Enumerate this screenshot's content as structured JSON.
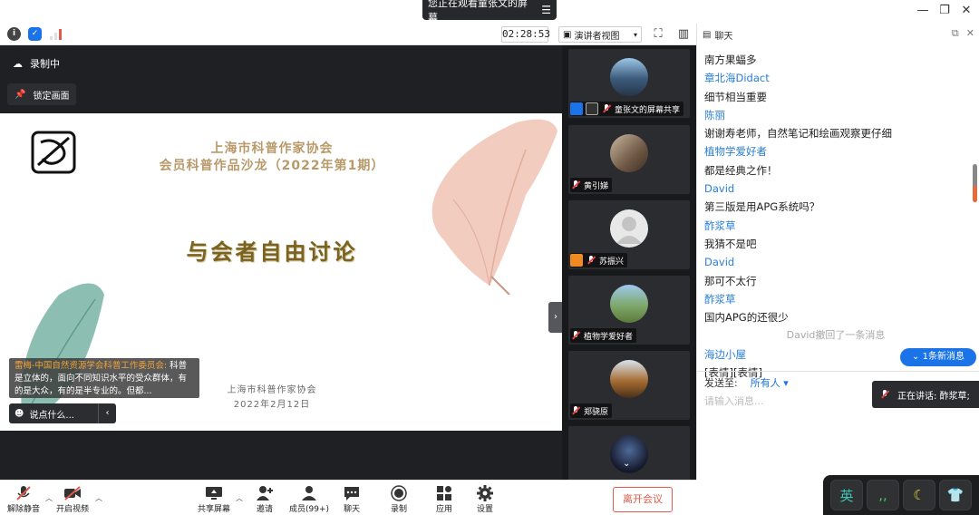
{
  "titlebar": {
    "share_banner": "您正在观看童张文的屏幕",
    "menu_icon": "menu-icon"
  },
  "toolbar": {
    "timer": "02:28:53",
    "view_label": "演讲者视图",
    "icons": [
      "info-icon",
      "shield-icon",
      "signal-icon",
      "fullscreen-icon",
      "sidebar-toggle-icon"
    ]
  },
  "stage": {
    "recording_label": "录制中",
    "lock_label": "锁定画面",
    "slide": {
      "title_line1": "上海市科普作家协会",
      "title_line2": "会员科普作品沙龙（2022年第1期）",
      "heading": "与会者自由讨论",
      "org": "上海市科普作家协会",
      "date": "2022年2月12日"
    },
    "comment": {
      "author": "雷梅-中国自然资源学会科普工作委员会:",
      "text": " 科普是立体的，面向不同知识水平的受众群体，有的是大众，有的是半专业的。但都..."
    },
    "say_placeholder": "说点什么..."
  },
  "gallery": [
    {
      "name": "童张文的屏幕共享"
    },
    {
      "name": "黄引娣"
    },
    {
      "name": "苏振兴"
    },
    {
      "name": "植物学爱好者"
    },
    {
      "name": "郑骁原"
    },
    {
      "name": ""
    }
  ],
  "chat": {
    "title": "聊天",
    "messages": [
      {
        "kind": "text",
        "content": "南方果蝠多"
      },
      {
        "kind": "name",
        "content": "章北海Didact"
      },
      {
        "kind": "text",
        "content": "细节相当重要"
      },
      {
        "kind": "name",
        "content": "陈丽"
      },
      {
        "kind": "text",
        "content": "谢谢寿老师，自然笔记和绘画观察更仔细"
      },
      {
        "kind": "name",
        "content": "植物学爱好者"
      },
      {
        "kind": "text",
        "content": "都是经典之作！"
      },
      {
        "kind": "name",
        "content": "David"
      },
      {
        "kind": "text",
        "content": "第三版是用APG系统吗？"
      },
      {
        "kind": "name",
        "content": "酢浆草"
      },
      {
        "kind": "text",
        "content": "我猜不是吧"
      },
      {
        "kind": "name",
        "content": "David"
      },
      {
        "kind": "text",
        "content": "那可不太行"
      },
      {
        "kind": "name",
        "content": "酢浆草"
      },
      {
        "kind": "text",
        "content": "国内APG的还很少"
      },
      {
        "kind": "notice",
        "content": "David撤回了一条消息"
      },
      {
        "kind": "name",
        "content": "海边小屋"
      },
      {
        "kind": "text",
        "content": "[表情][表情]"
      }
    ],
    "new_messages": "1条新消息",
    "send_to_label": "发送至:",
    "send_to_value": "所有人",
    "input_placeholder": "请输入消息...",
    "speaking": "正在讲话: 酢浆草;"
  },
  "bottombar": {
    "unmute": "解除静音",
    "start_video": "开启视频",
    "share_screen": "共享屏幕",
    "invite": "邀请",
    "members": "成员(99+)",
    "chat": "聊天",
    "record": "录制",
    "apps": "应用",
    "settings": "设置",
    "leave": "离开会议"
  },
  "ime": {
    "lang": "英"
  },
  "colors": {
    "accent": "#1a74e8",
    "leave": "#e05a4a",
    "chat_name": "#2a7ed6"
  }
}
